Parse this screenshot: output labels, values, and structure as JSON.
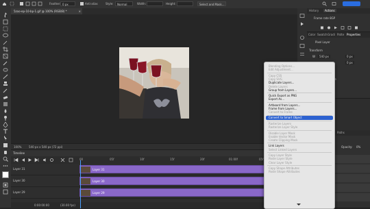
{
  "options_bar": {
    "feather_label": "Feather:",
    "feather_value": "0 px",
    "antialias_label": "Anti-alias",
    "style_label": "Style:",
    "style_value": "Normal",
    "width_label": "Width:",
    "height_label": "Height:",
    "select_mask_label": "Select and Mask..."
  },
  "document_tab": {
    "title": "5zoo-ep-10-bp-1.gif @ 100% (RGB/8) *",
    "close": "×"
  },
  "status_bar": {
    "zoom": "100%",
    "doc_info": "540 px x 540 px (72 ppi)"
  },
  "timeline": {
    "title": "Timeline",
    "ruler_ticks": [
      "00",
      "05f",
      "10f",
      "15f",
      "20f",
      "01:00f",
      "05f"
    ],
    "tracks": [
      {
        "name": "Layer 31",
        "bar_label": "Layer 31"
      },
      {
        "name": "Layer 30",
        "bar_label": "Layer 30"
      },
      {
        "name": "Layer 29",
        "bar_label": "Layer 29"
      }
    ],
    "timecode": "0:00:00:00",
    "fps": "(30.00 fps)"
  },
  "right_panels": {
    "top_tabs": [
      "History",
      "Actions"
    ],
    "actions_item": "Frame rate 8GP",
    "props_tabs": [
      "Color",
      "Swatch",
      "Gradi",
      "Patte",
      "Properties"
    ],
    "pixel_layer_label": "Pixel Layer",
    "transform_label": "Transform",
    "w_label": "W",
    "w_value": "540 px",
    "x_value": "0 px",
    "h_value": "0 px",
    "angle_value": "0.00°",
    "align_label": "Align and Distribute",
    "adjustments_label": "Adjustments",
    "layers_tabs": [
      "Layers",
      "Channels",
      "Paths"
    ],
    "kind_label": "Kind",
    "opacity_label": "Opacity:",
    "opacity_value": "0%"
  },
  "context_menu": {
    "items": [
      {
        "label": "Blending Options...",
        "disabled": true
      },
      {
        "label": "Edit Adjustment...",
        "disabled": true
      },
      {
        "sep": true
      },
      {
        "label": "Copy CSS",
        "disabled": true
      },
      {
        "label": "Copy SVG",
        "disabled": true
      },
      {
        "label": "Duplicate Layers...",
        "disabled": false
      },
      {
        "label": "Delete Layers",
        "disabled": true
      },
      {
        "label": "Group from Layers...",
        "disabled": false
      },
      {
        "sep": true
      },
      {
        "label": "Quick Export as PNG",
        "disabled": false
      },
      {
        "label": "Export As...",
        "disabled": false
      },
      {
        "sep": true
      },
      {
        "label": "Artboard from Layers...",
        "disabled": false
      },
      {
        "label": "Frame from Layers...",
        "disabled": false
      },
      {
        "label": "Convert to Frame",
        "disabled": true
      },
      {
        "sep": true
      },
      {
        "label": "Convert to Smart Object",
        "disabled": false,
        "highlighted": true
      },
      {
        "sep": true
      },
      {
        "label": "Rasterize Layers",
        "disabled": true
      },
      {
        "label": "Rasterize Layer Style",
        "disabled": true
      },
      {
        "sep": true
      },
      {
        "label": "Disable Layer Mask",
        "disabled": true
      },
      {
        "label": "Enable Vector Mask",
        "disabled": true
      },
      {
        "label": "Create Clipping Mask",
        "disabled": true
      },
      {
        "sep": true
      },
      {
        "label": "Link Layers",
        "disabled": false
      },
      {
        "label": "Select Linked Layers",
        "disabled": true
      },
      {
        "sep": true
      },
      {
        "label": "Copy Layer Style",
        "disabled": true
      },
      {
        "label": "Paste Layer Style",
        "disabled": true
      },
      {
        "label": "Clear Layer Style",
        "disabled": true
      },
      {
        "sep": true
      },
      {
        "label": "Copy Shape Attributes",
        "disabled": true
      },
      {
        "label": "Paste Shape Attributes",
        "disabled": true
      }
    ]
  },
  "colors": {
    "highlight": "#2d62d0",
    "track": "#8a68c9",
    "playhead": "#4aa0ff"
  }
}
